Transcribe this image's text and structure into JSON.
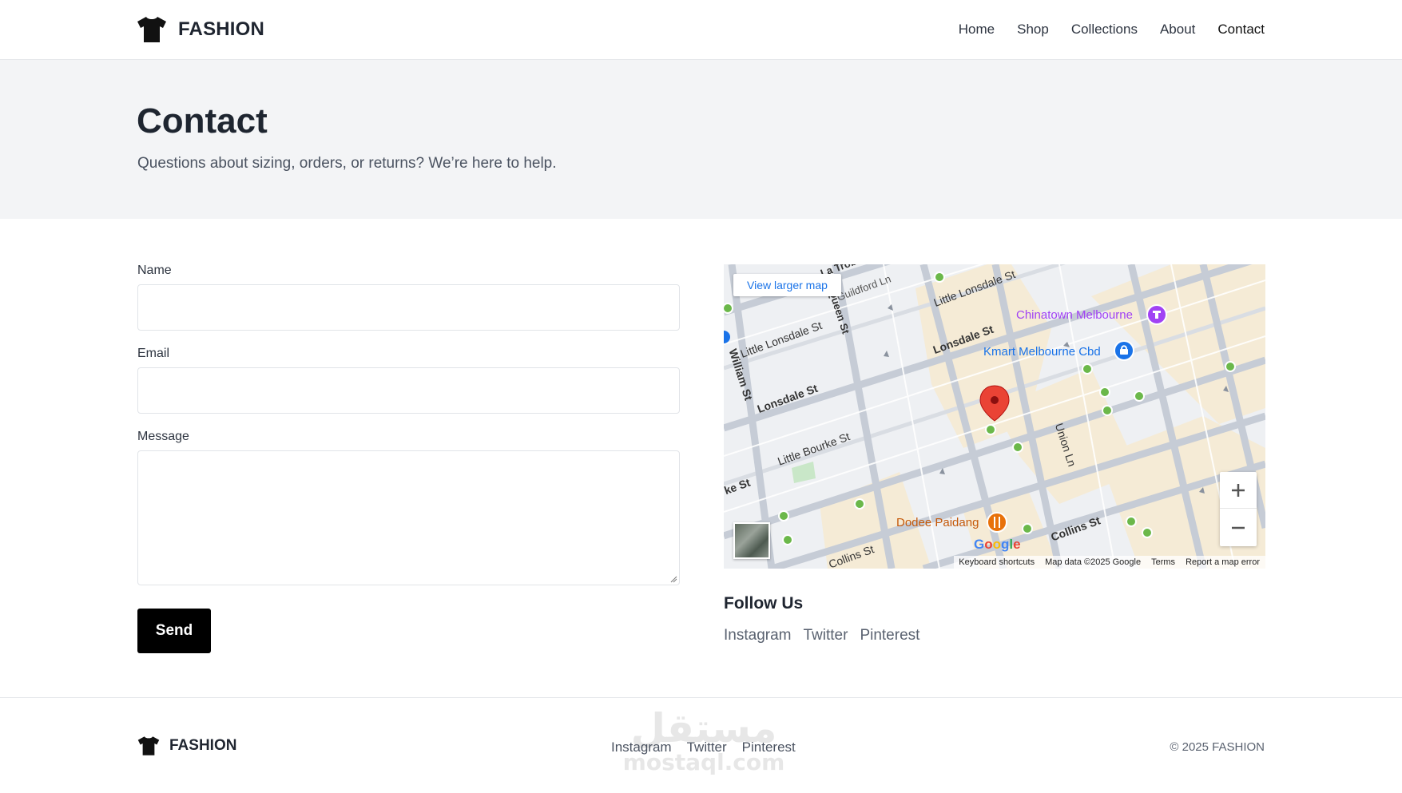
{
  "brand": {
    "name": "FASHION",
    "icon": "tshirt-icon"
  },
  "nav": {
    "items": [
      {
        "label": "Home",
        "active": false
      },
      {
        "label": "Shop",
        "active": false
      },
      {
        "label": "Collections",
        "active": false
      },
      {
        "label": "About",
        "active": false
      },
      {
        "label": "Contact",
        "active": true
      }
    ]
  },
  "hero": {
    "title": "Contact",
    "subtitle": "Questions about sizing, orders, or returns? We’re here to help."
  },
  "form": {
    "name_label": "Name",
    "name_value": "",
    "email_label": "Email",
    "email_value": "",
    "message_label": "Message",
    "message_value": "",
    "send_label": "Send"
  },
  "map": {
    "view_larger": "View larger map",
    "streets": [
      "Little Lonsdale St",
      "Lonsdale St",
      "Little Bourke St",
      "Collins St",
      "William St",
      "Union Ln",
      "Guildford Ln",
      "Queen St",
      "ke St",
      "La Trob"
    ],
    "places": [
      {
        "name": "Chinatown Melbourne",
        "color": "#a142f4"
      },
      {
        "name": "Kmart Melbourne Cbd",
        "color": "#1a73e8"
      },
      {
        "name": "Dodee Paidang",
        "color": "#e8710a"
      }
    ],
    "google_logo": "Google",
    "attribution": {
      "keyboard": "Keyboard shortcuts",
      "data": "Map data ©2025 Google",
      "terms": "Terms",
      "report": "Report a map error"
    },
    "zoom_in": "+",
    "zoom_out": "−"
  },
  "follow": {
    "title": "Follow Us",
    "links": [
      "Instagram",
      "Twitter",
      "Pinterest"
    ]
  },
  "footer": {
    "brand": "FASHION",
    "links": [
      "Instagram",
      "Twitter",
      "Pinterest"
    ],
    "copyright": "© 2025 FASHION"
  },
  "colors": {
    "primary": "#000000",
    "hero_bg": "#f3f4f6",
    "text": "#1f2530",
    "muted": "#5a6270"
  }
}
